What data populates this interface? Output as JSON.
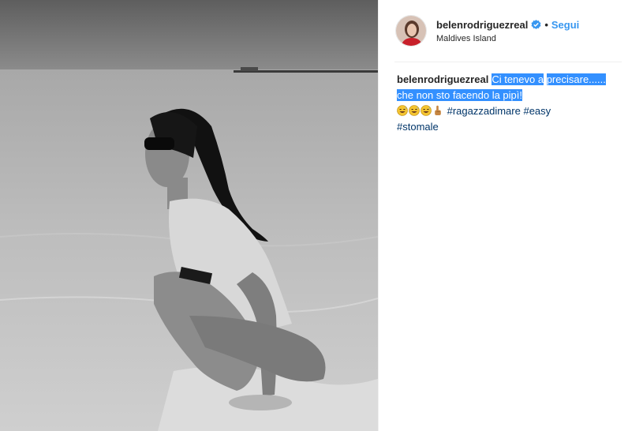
{
  "post": {
    "username": "belenrodriguezreal",
    "follow_label": "Segui",
    "separator": "•",
    "location": "Maldives Island",
    "caption_highlight_line1": "Ci tenevo a",
    "caption_highlight_line2": "precisare...... che non sto facendo la pipì!",
    "hashtags": [
      "#ragazzadimare",
      "#easy",
      "#stomale"
    ]
  },
  "icons": {
    "verified": "verified-badge-icon",
    "emoji_1": "grinning-sweat-emoji",
    "emoji_2": "grinning-sweat-emoji",
    "emoji_3": "grinning-sweat-emoji",
    "emoji_4": "pointing-up-emoji"
  },
  "colors": {
    "link_blue": "#3897f0",
    "hashtag": "#003569",
    "selection": "#3390ff",
    "text": "#262626"
  }
}
